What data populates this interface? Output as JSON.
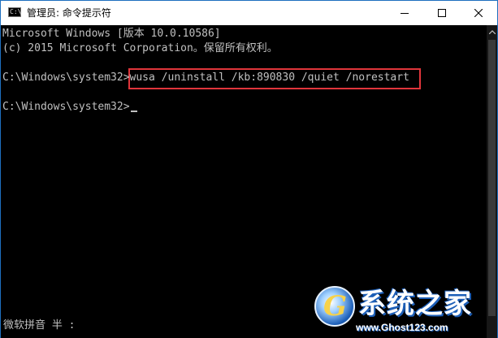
{
  "window": {
    "title": "管理员: 命令提示符",
    "icon": "cmd-icon",
    "icon_text": "C:\\",
    "border_color": "#1e6fbf"
  },
  "console": {
    "lines": [
      "Microsoft Windows [版本 10.0.10586]",
      "(c) 2015 Microsoft Corporation。保留所有权利。",
      "C:\\Windows\\system32>wusa /uninstall /kb:890830 /quiet /norestart",
      "C:\\Windows\\system32>"
    ],
    "highlight_color": "#e0353b",
    "ime_status": "微软拼音 半 :"
  },
  "watermark": {
    "brand": "系统之家",
    "logo_letter": "G",
    "url": "www.Ghost123.com"
  }
}
